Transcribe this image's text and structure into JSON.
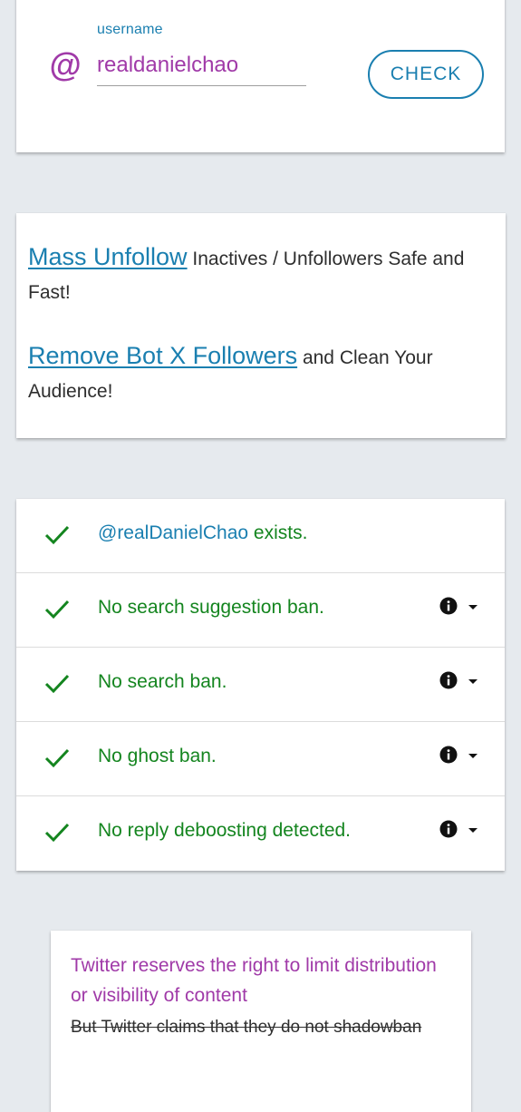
{
  "search": {
    "label": "username",
    "at_symbol": "@",
    "value": "realdanielchao",
    "check_label": "CHECK"
  },
  "promo": {
    "item1_link": "Mass Unfollow",
    "item1_text": " Inactives / Unfollowers Safe and Fast!",
    "item2_link": "Remove Bot X Followers",
    "item2_text": " and Clean Your Audience!"
  },
  "results": {
    "exists_handle": "@realDanielChao",
    "exists_text": " exists.",
    "rows": [
      {
        "text": "No search suggestion ban."
      },
      {
        "text": "No search ban."
      },
      {
        "text": "No ghost ban."
      },
      {
        "text": "No reply deboosting detected."
      }
    ]
  },
  "quote": {
    "main": "Twitter reserves the right to limit distribution or visibility of content",
    "strike": "But Twitter claims that they do not shadowban"
  },
  "colors": {
    "accent_blue": "#1a7fb0",
    "accent_purple": "#a03aa8",
    "success_green": "#14851f",
    "background": "#e6eaee"
  },
  "icons": {
    "at": "at-icon",
    "check": "check-icon",
    "info": "info-icon",
    "caret": "caret-down-icon"
  }
}
